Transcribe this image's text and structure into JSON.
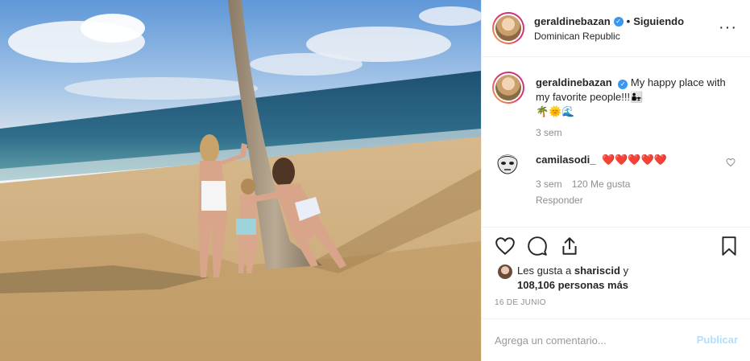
{
  "post": {
    "image_icon": "beach-photo"
  },
  "header": {
    "username": "geraldinebazan",
    "separator": "•",
    "follow_status": "Siguiendo",
    "location": "Dominican Republic",
    "more_icon": "more-options-icon",
    "more_glyph": "···"
  },
  "caption": {
    "username": "geraldinebazan",
    "text": "My happy place with my favorite people!!!👨‍👧",
    "emojis": "🌴🌞🌊",
    "time": "3 sem"
  },
  "comment": {
    "username": "camilasodi_",
    "text": "❤️❤️❤️❤️❤️",
    "time": "3 sem",
    "likes": "120 Me gusta",
    "reply_label": "Responder"
  },
  "actions": {
    "like_icon": "heart-icon",
    "comment_icon": "comment-icon",
    "share_icon": "share-icon",
    "save_icon": "bookmark-icon"
  },
  "likes": {
    "prefix": "Les gusta a",
    "user": "shariscid",
    "connector": "y",
    "count": "108,106 personas más"
  },
  "date": "16 DE JUNIO",
  "add_comment": {
    "placeholder": "Agrega un comentario...",
    "publish_label": "Publicar"
  },
  "colors": {
    "verified": "#3897f0",
    "publish_disabled": "#b2dffc",
    "muted_text": "#8e8e8e",
    "border": "#efefef"
  }
}
